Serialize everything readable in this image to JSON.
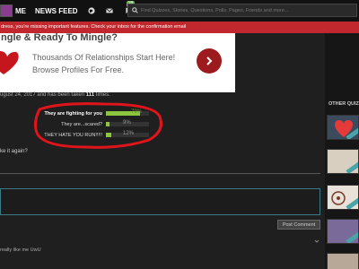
{
  "nav": {
    "me_label": "ME",
    "newsfeed_label": "NEWS FEED",
    "notification_count": "18",
    "search_placeholder": "Find Quizzes, Stories, Questions, Polls, Pages, Friends and more..."
  },
  "alert": {
    "text": "dress, you're missing important features. Check your inbox for the confirmation email"
  },
  "ad": {
    "title": "ngle & Ready To Mingle?",
    "line1": "Thousands Of Relationships Start Here!",
    "line2": "Browse Profiles For Free."
  },
  "meta": {
    "prefix": "ugust 24, 2017",
    "mid": " and has been taken ",
    "count": "111",
    "suffix": " times."
  },
  "results": [
    {
      "label": "They are fighting for you",
      "percent": 79,
      "pct_label": "79%"
    },
    {
      "label": "They are...scared?",
      "percent": 9,
      "pct_label": "9%"
    },
    {
      "label": "THEY HATE YOU RUN!!!!!",
      "percent": 12,
      "pct_label": "12%"
    }
  ],
  "retake": "ke it again?",
  "post_comment_label": "Post Comment",
  "comment_text": "really like me UwU",
  "sidebar": {
    "title": "OTHER QUIZ"
  },
  "colors": {
    "alert": "#c0282d",
    "bar": "#8cc63f",
    "ad_button": "#9b1b1e",
    "highlight_circle": "#e0141b"
  }
}
